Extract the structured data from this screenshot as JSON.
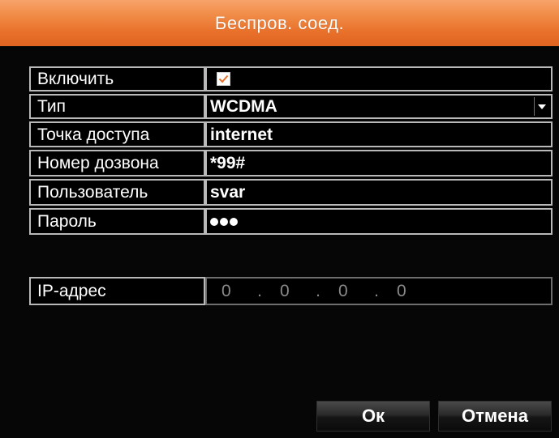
{
  "window": {
    "title": "Беспров. соед."
  },
  "form": {
    "enable": {
      "label": "Включить",
      "checked": true
    },
    "type": {
      "label": "Тип",
      "value": "WCDMA"
    },
    "access_point": {
      "label": "Точка доступа",
      "value": "internet"
    },
    "dial_number": {
      "label": "Номер дозвона",
      "value": "*99#"
    },
    "user": {
      "label": "Пользователь",
      "value": "svar"
    },
    "password": {
      "label": "Пароль",
      "masked_length": 3
    },
    "ip_address": {
      "label": "IP-адрес",
      "octets": [
        "0",
        "0",
        "0",
        "0"
      ],
      "separator": "."
    }
  },
  "buttons": {
    "ok_label": "Ок",
    "cancel_label": "Отмена"
  },
  "colors": {
    "title_bar": "#e8702a",
    "background": "#060606",
    "cell_border": "#b9b9b9",
    "checkmark": "#e8702a"
  },
  "icons": {
    "checkbox": "check-icon",
    "dropdown": "dropdown-arrow-icon"
  }
}
